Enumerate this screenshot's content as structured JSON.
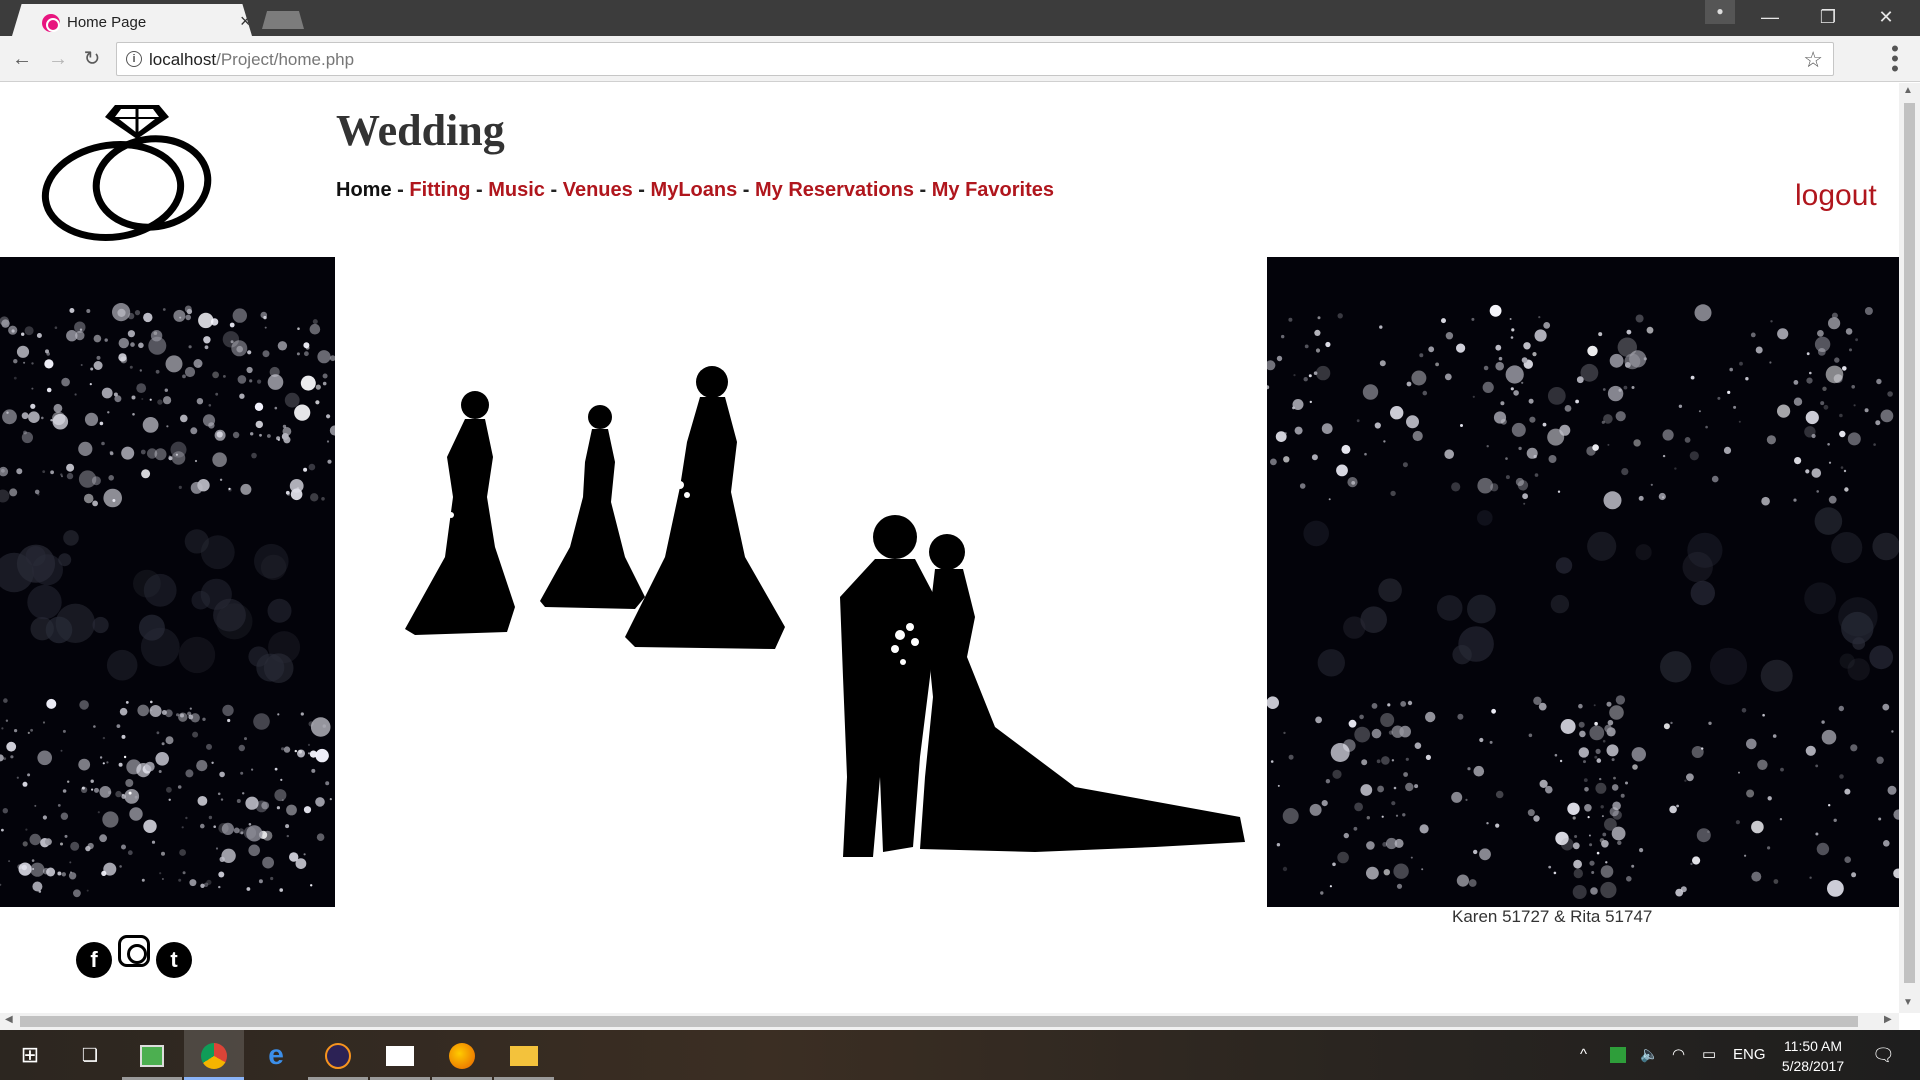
{
  "browser": {
    "tab_title": "Home Page",
    "tab_close": "×",
    "url_host": "localhost",
    "url_path": "/Project/home.php",
    "back": "←",
    "forward": "→",
    "reload": "↻",
    "star": "☆",
    "info": "i",
    "menu": "⋮",
    "minimize": "—",
    "restore": "❐",
    "close": "✕",
    "profile": "👤"
  },
  "site": {
    "title": "Wedding",
    "nav": [
      {
        "label": "Home"
      },
      {
        "label": "Fitting"
      },
      {
        "label": "Music"
      },
      {
        "label": "Venues"
      },
      {
        "label": "MyLoans"
      },
      {
        "label": "My Reservations"
      },
      {
        "label": "My Favorites"
      }
    ],
    "separator": " - ",
    "logout": "logout",
    "credits": "Karen 51727 & Rita 51747",
    "social": {
      "facebook": "f",
      "twitter": "t"
    },
    "colors": {
      "link": "#b0161d",
      "active": "#111111",
      "sparkle_bg": "#03030a"
    }
  },
  "taskbar": {
    "start": "⊞",
    "task_view": "❏",
    "apps": [
      {
        "name": "photos-app"
      },
      {
        "name": "chrome"
      },
      {
        "name": "edge"
      },
      {
        "name": "eclipse"
      },
      {
        "name": "mail"
      },
      {
        "name": "firefox"
      },
      {
        "name": "file-explorer"
      }
    ],
    "tray_chevron": "^",
    "language": "ENG",
    "time": "11:50 AM",
    "date": "5/28/2017",
    "notifications": "🗨"
  }
}
